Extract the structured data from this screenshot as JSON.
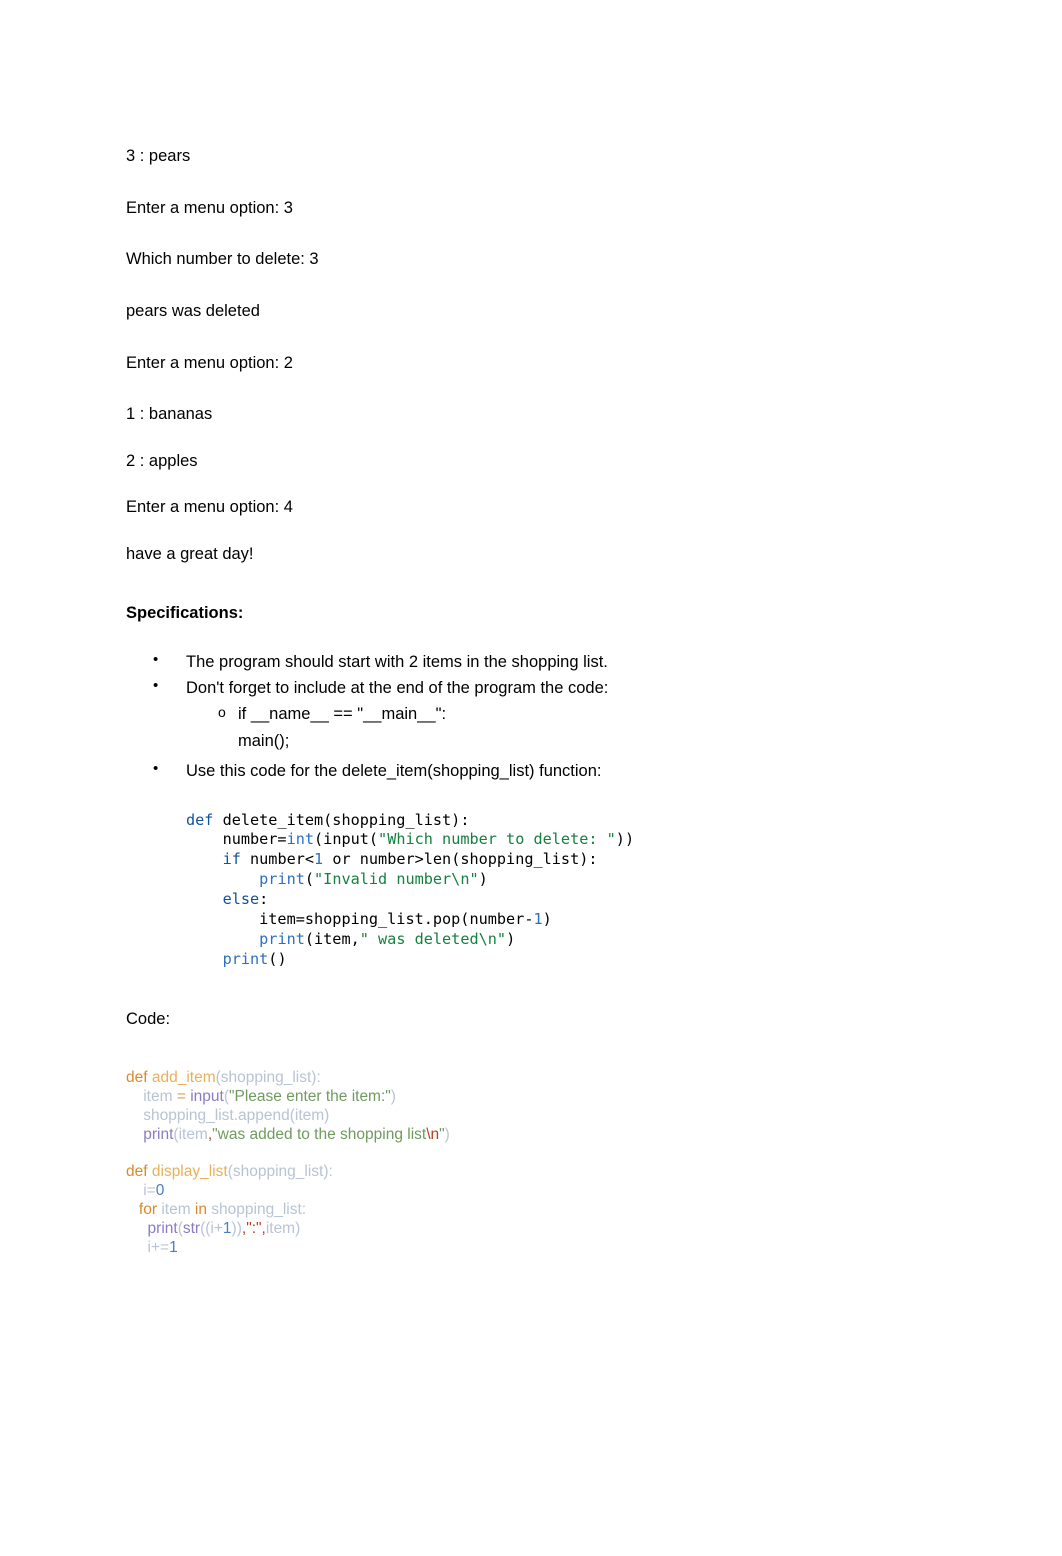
{
  "document": {
    "transcript": [
      "3 : pears",
      "Enter a menu option: 3",
      "Which number to delete: 3",
      "pears was deleted",
      "Enter a menu option: 2",
      "1 : bananas",
      "2 : apples",
      "Enter a menu option: 4",
      "have a great day!"
    ],
    "specifications": {
      "heading": "Specifications:",
      "bullets": [
        "The program should start with 2 items in the shopping list.",
        "Don't forget to include at the end of the program the code:"
      ],
      "sub_bullet": "if __name__ == \"__main__\":",
      "sub_bullet_continued": "main();",
      "bullet_three": "Use this code for the delete_item(shopping_list) function:"
    },
    "code_block_idle": {
      "lines": [
        [
          {
            "t": "def",
            "c": "kw"
          },
          {
            "t": " delete_item(shopping_list):",
            "c": "pln"
          }
        ],
        [
          {
            "t": "    number=",
            "c": "pln"
          },
          {
            "t": "int",
            "c": "bi"
          },
          {
            "t": "(input(",
            "c": "pln"
          },
          {
            "t": "\"Which number to delete: \"",
            "c": "str"
          },
          {
            "t": "))",
            "c": "pln"
          }
        ],
        [
          {
            "t": "    ",
            "c": "pln"
          },
          {
            "t": "if",
            "c": "kw"
          },
          {
            "t": " number<",
            "c": "pln"
          },
          {
            "t": "1",
            "c": "num"
          },
          {
            "t": " or number>len(shopping_list):",
            "c": "pln"
          }
        ],
        [
          {
            "t": "        ",
            "c": "pln"
          },
          {
            "t": "print",
            "c": "bi"
          },
          {
            "t": "(",
            "c": "pln"
          },
          {
            "t": "\"Invalid number\\n\"",
            "c": "str"
          },
          {
            "t": ")",
            "c": "pln"
          }
        ],
        [
          {
            "t": "    ",
            "c": "pln"
          },
          {
            "t": "else",
            "c": "kw"
          },
          {
            "t": ":",
            "c": "pln"
          }
        ],
        [
          {
            "t": "        item=shopping_list.pop(number-",
            "c": "pln"
          },
          {
            "t": "1",
            "c": "num"
          },
          {
            "t": ")",
            "c": "pln"
          }
        ],
        [
          {
            "t": "        ",
            "c": "pln"
          },
          {
            "t": "print",
            "c": "bi"
          },
          {
            "t": "(item,",
            "c": "pln"
          },
          {
            "t": "\" was deleted\\n\"",
            "c": "str"
          },
          {
            "t": ")",
            "c": "pln"
          }
        ],
        [
          {
            "t": "    ",
            "c": "pln"
          },
          {
            "t": "print",
            "c": "bi"
          },
          {
            "t": "()",
            "c": "pln"
          }
        ]
      ]
    },
    "code_label": "Code:",
    "code_block_theme": {
      "lines": [
        [
          {
            "t": "def",
            "c": "t-kw"
          },
          {
            "t": " ",
            "c": "t-var"
          },
          {
            "t": "add_item",
            "c": "t-fn"
          },
          {
            "t": "(shopping_list):",
            "c": "t-var"
          }
        ],
        [
          {
            "t": "    item ",
            "c": "t-var"
          },
          {
            "t": "=",
            "c": "t-op"
          },
          {
            "t": " ",
            "c": "t-var"
          },
          {
            "t": "input",
            "c": "t-fun"
          },
          {
            "t": "(",
            "c": "t-var"
          },
          {
            "t": "\"Please enter the item:\"",
            "c": "t-str"
          },
          {
            "t": ")",
            "c": "t-var"
          }
        ],
        [
          {
            "t": "    shopping_list.append(item)",
            "c": "t-var"
          }
        ],
        [
          {
            "t": "    ",
            "c": "t-var"
          },
          {
            "t": "print",
            "c": "t-fun"
          },
          {
            "t": "(",
            "c": "t-var"
          },
          {
            "t": "item",
            "c": "t-var"
          },
          {
            "t": ",",
            "c": "t-red"
          },
          {
            "t": "\"was added to the shopping list",
            "c": "t-str"
          },
          {
            "t": "\\n",
            "c": "t-red"
          },
          {
            "t": "\"",
            "c": "t-str"
          },
          {
            "t": ")",
            "c": "t-var"
          }
        ],
        [],
        [
          {
            "t": "def",
            "c": "t-kw"
          },
          {
            "t": " ",
            "c": "t-var"
          },
          {
            "t": "display_list",
            "c": "t-fn"
          },
          {
            "t": "(shopping_list):",
            "c": "t-var"
          }
        ],
        [
          {
            "t": "    i=",
            "c": "t-var"
          },
          {
            "t": "0",
            "c": "t-num"
          }
        ],
        [
          {
            "t": "   ",
            "c": "t-var"
          },
          {
            "t": "for",
            "c": "t-kw"
          },
          {
            "t": " item ",
            "c": "t-var"
          },
          {
            "t": "in",
            "c": "t-kw"
          },
          {
            "t": " shopping_list:",
            "c": "t-var"
          }
        ],
        [
          {
            "t": "     ",
            "c": "t-var"
          },
          {
            "t": "print",
            "c": "t-fun"
          },
          {
            "t": "(",
            "c": "t-var"
          },
          {
            "t": "str",
            "c": "t-fun"
          },
          {
            "t": "((i+",
            "c": "t-var"
          },
          {
            "t": "1",
            "c": "t-num"
          },
          {
            "t": "))",
            "c": "t-var"
          },
          {
            "t": ",",
            "c": "t-red"
          },
          {
            "t": "\":\"",
            "c": "t-red"
          },
          {
            "t": ",",
            "c": "t-red"
          },
          {
            "t": "item)",
            "c": "t-var"
          }
        ],
        [
          {
            "t": "     i+=",
            "c": "t-var"
          },
          {
            "t": "1",
            "c": "t-num"
          }
        ]
      ]
    }
  }
}
